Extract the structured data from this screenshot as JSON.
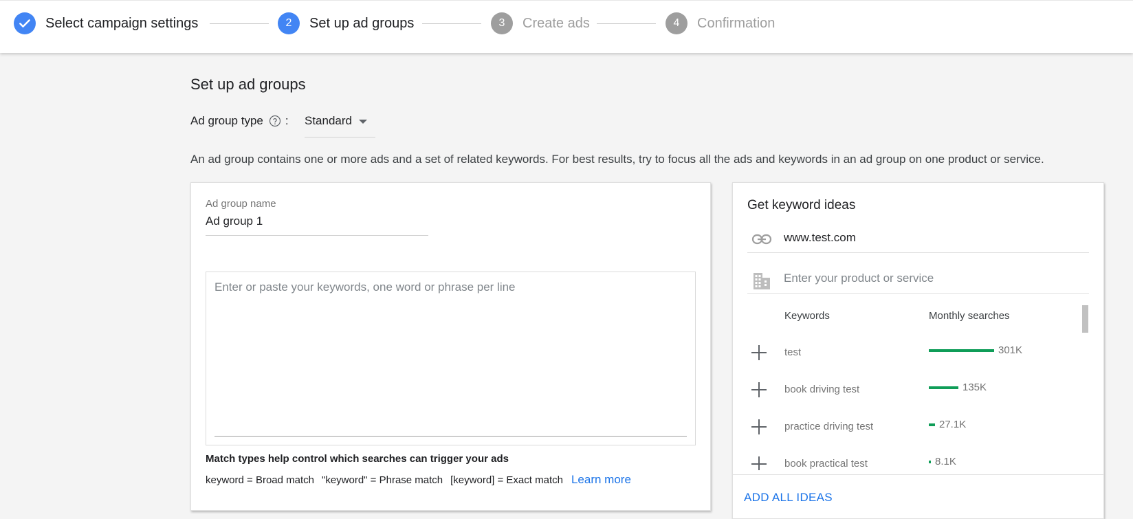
{
  "stepper": {
    "steps": [
      {
        "number": "",
        "label": "Select campaign settings",
        "state": "done"
      },
      {
        "number": "2",
        "label": "Set up ad groups",
        "state": "active"
      },
      {
        "number": "3",
        "label": "Create ads",
        "state": "todo"
      },
      {
        "number": "4",
        "label": "Confirmation",
        "state": "todo"
      }
    ]
  },
  "page": {
    "title": "Set up ad groups",
    "ad_group_type_label": "Ad group type",
    "colon": ":",
    "ad_group_type_value": "Standard",
    "description": "An ad group contains one or more ads and a set of related keywords. For best results, try to focus all the ads and keywords in an ad group on one product or service."
  },
  "ad_group": {
    "name_label": "Ad group name",
    "name_value": "Ad group 1",
    "keywords_placeholder": "Enter or paste your keywords, one word or phrase per line",
    "match_title": "Match types help control which searches can trigger your ads",
    "match_broad": "keyword = Broad match",
    "match_phrase": "\"keyword\" = Phrase match",
    "match_exact": "[keyword] = Exact match",
    "learn_more": "Learn more"
  },
  "keyword_ideas": {
    "title": "Get keyword ideas",
    "url_value": "www.test.com",
    "product_placeholder": "Enter your product or service",
    "col_keywords": "Keywords",
    "col_monthly": "Monthly searches",
    "rows": [
      {
        "keyword": "test",
        "searches": "301K",
        "share": 1.0
      },
      {
        "keyword": "book driving test",
        "searches": "135K",
        "share": 0.448
      },
      {
        "keyword": "practice driving test",
        "searches": "27.1K",
        "share": 0.09
      },
      {
        "keyword": "book practical test",
        "searches": "8.1K",
        "share": 0.027
      }
    ],
    "add_all": "ADD ALL IDEAS"
  },
  "colors": {
    "accent": "#4285f4",
    "link": "#1a73e8",
    "bar": "#0f9d58",
    "inactive": "#9e9e9e"
  },
  "icons": {
    "step_done": "check-icon",
    "ad_group_type_help": "help-circle-icon",
    "url": "link-icon",
    "product": "building-icon",
    "add": "plus-icon",
    "dropdown": "caret-down-icon"
  }
}
